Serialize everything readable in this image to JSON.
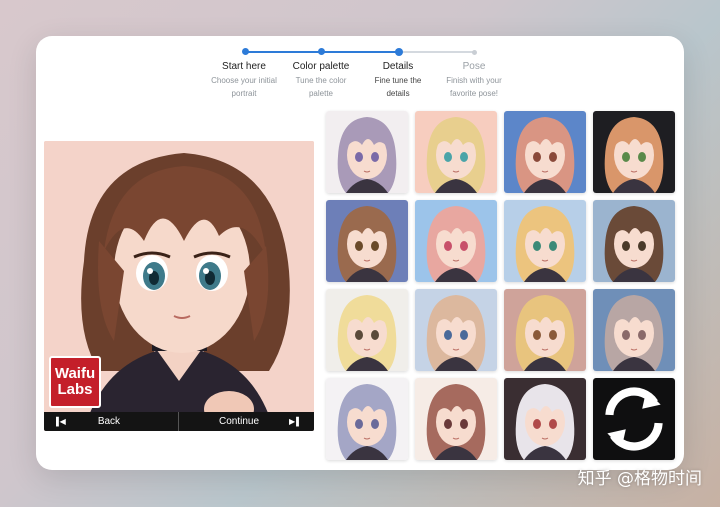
{
  "stepper": {
    "steps": [
      {
        "title": "Start here",
        "desc1": "Choose your initial",
        "desc2": "portrait"
      },
      {
        "title": "Color palette",
        "desc1": "Tune the color",
        "desc2": "palette"
      },
      {
        "title": "Details",
        "desc1": "Fine tune the",
        "desc2": "details"
      },
      {
        "title": "Pose",
        "desc1": "Finish with your",
        "desc2": "favorite pose!"
      }
    ],
    "current_step": 3
  },
  "portrait": {
    "logo_line1": "Waifu",
    "logo_line2": "Labs",
    "back_label": "Back",
    "continue_label": "Continue"
  },
  "grid": {
    "tiles": [
      {
        "bg": "#f2eef0",
        "hair": "#a99ab8",
        "eyes": "#7a6aa8"
      },
      {
        "bg": "#f7cdbf",
        "hair": "#e8cf8e",
        "eyes": "#4aa4a8"
      },
      {
        "bg": "#5c86c9",
        "hair": "#d99583",
        "eyes": "#8a4a3a"
      },
      {
        "bg": "#1e1e22",
        "hair": "#d9966a",
        "eyes": "#5a8a4a"
      },
      {
        "bg": "#6d7fb8",
        "hair": "#9a6a4e",
        "eyes": "#6a4a2a"
      },
      {
        "bg": "#9cc4ea",
        "hair": "#e8a7a0",
        "eyes": "#c8506a"
      },
      {
        "bg": "#b7cfe8",
        "hair": "#ecc47e",
        "eyes": "#3c8a78"
      },
      {
        "bg": "#9bb4cf",
        "hair": "#6a4a38",
        "eyes": "#4a3a2a"
      },
      {
        "bg": "#f0eeea",
        "hair": "#f0dc9a",
        "eyes": "#5a4a3a"
      },
      {
        "bg": "#c5d3e6",
        "hair": "#dcb89e",
        "eyes": "#4a6a9a"
      },
      {
        "bg": "#cfa39a",
        "hair": "#e8c47e",
        "eyes": "#8a5a3a"
      },
      {
        "bg": "#6f8fb8",
        "hair": "#b8a6a4",
        "eyes": "#8a6a6a"
      },
      {
        "bg": "#f4f2f4",
        "hair": "#a4a6c6",
        "eyes": "#6a6a9a"
      },
      {
        "bg": "#f6ece6",
        "hair": "#a66a5e",
        "eyes": "#6a3a3a"
      },
      {
        "bg": "#3a2e32",
        "hair": "#e8e4ea",
        "eyes": "#b04a4a"
      }
    ],
    "refresh_icon": "refresh-icon"
  },
  "watermark": "知乎 @格物时间"
}
